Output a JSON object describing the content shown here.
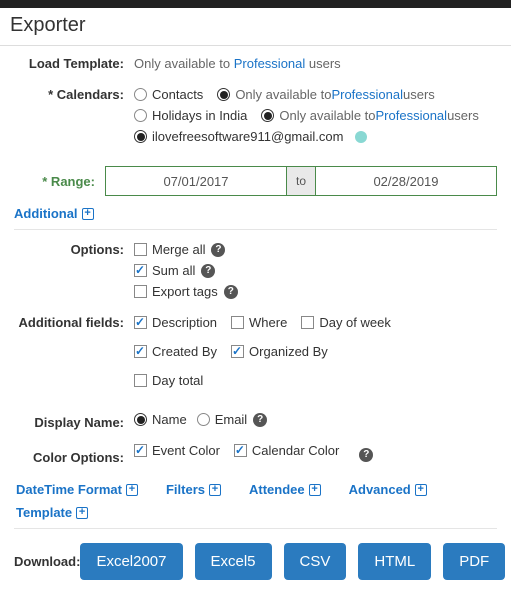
{
  "title": "Exporter",
  "load_template": {
    "label": "Load Template:",
    "text_prefix": "Only available to ",
    "text_link": "Professional",
    "text_suffix": " users"
  },
  "calendars": {
    "label": "* Calendars:",
    "contacts_label": "Contacts",
    "pro_prefix": "Only available to ",
    "pro_link": "Professional",
    "pro_suffix": " users",
    "holidays_label": "Holidays in India",
    "email_label": "ilovefreesoftware911@gmail.com"
  },
  "range": {
    "label": "* Range:",
    "from": "07/01/2017",
    "to_label": "to",
    "to": "02/28/2019"
  },
  "additional_link": "Additional",
  "options": {
    "label": "Options:",
    "merge_all": "Merge all",
    "sum_all": "Sum all",
    "export_tags": "Export tags"
  },
  "additional_fields": {
    "label": "Additional fields:",
    "description": "Description",
    "where": "Where",
    "day_of_week": "Day of week",
    "created_by": "Created By",
    "organized_by": "Organized By",
    "day_total": "Day total"
  },
  "display_name": {
    "label": "Display Name:",
    "name": "Name",
    "email": "Email"
  },
  "color_options": {
    "label": "Color Options:",
    "event_color": "Event Color",
    "calendar_color": "Calendar Color"
  },
  "footer_links": {
    "datetime": "DateTime Format",
    "filters": "Filters",
    "attendee": "Attendee",
    "advanced": "Advanced",
    "template": "Template"
  },
  "download": {
    "label": "Download:",
    "excel2007": "Excel2007",
    "excel5": "Excel5",
    "csv": "CSV",
    "html": "HTML",
    "pdf": "PDF"
  }
}
